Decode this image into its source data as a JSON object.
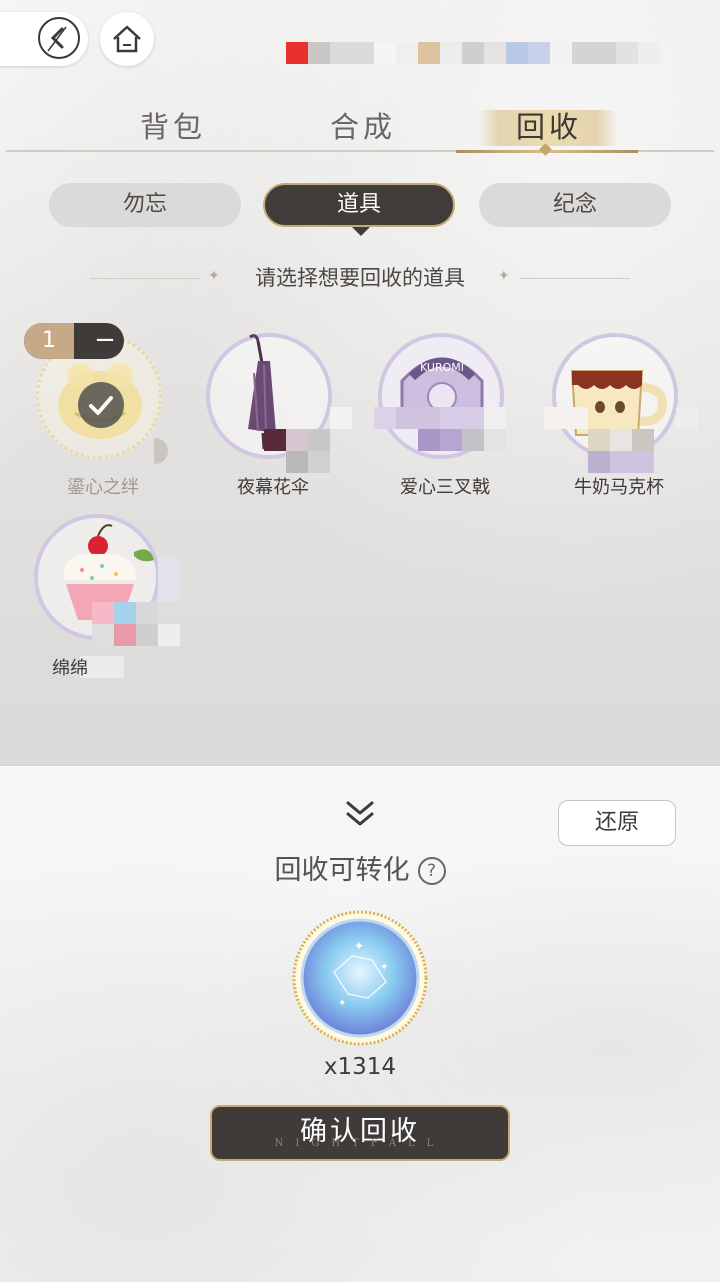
{
  "header": {
    "back_icon": "back-icon",
    "home_icon": "home-icon"
  },
  "main_tabs": [
    {
      "label": "背包",
      "active": false
    },
    {
      "label": "合成",
      "active": false
    },
    {
      "label": "回收",
      "active": true
    }
  ],
  "sub_tabs": [
    {
      "label": "勿忘",
      "active": false
    },
    {
      "label": "道具",
      "active": true
    },
    {
      "label": "纪念",
      "active": false
    }
  ],
  "prompt": "请选择想要回收的道具",
  "items": [
    {
      "name": "鎏心之绊",
      "selected": true,
      "quantity": "1"
    },
    {
      "name": "夜幕花伞",
      "selected": false
    },
    {
      "name": "爱心三叉戟",
      "selected": false
    },
    {
      "name": "牛奶马克杯",
      "selected": false
    },
    {
      "name": "绵绵",
      "selected": false
    }
  ],
  "quantity_control": {
    "count": "1",
    "minus": "−"
  },
  "restore_label": "还原",
  "convert_title": "回收可转化",
  "help_icon": "?",
  "reward": {
    "icon": "starlight-coin-icon",
    "count": "x1314"
  },
  "confirm_label": "确认回收",
  "confirm_watermark": "NIGHTFALL",
  "colors": {
    "accent_gold": "#c7a973",
    "dark": "#3e3b39",
    "ring": "#cfc8e0"
  }
}
